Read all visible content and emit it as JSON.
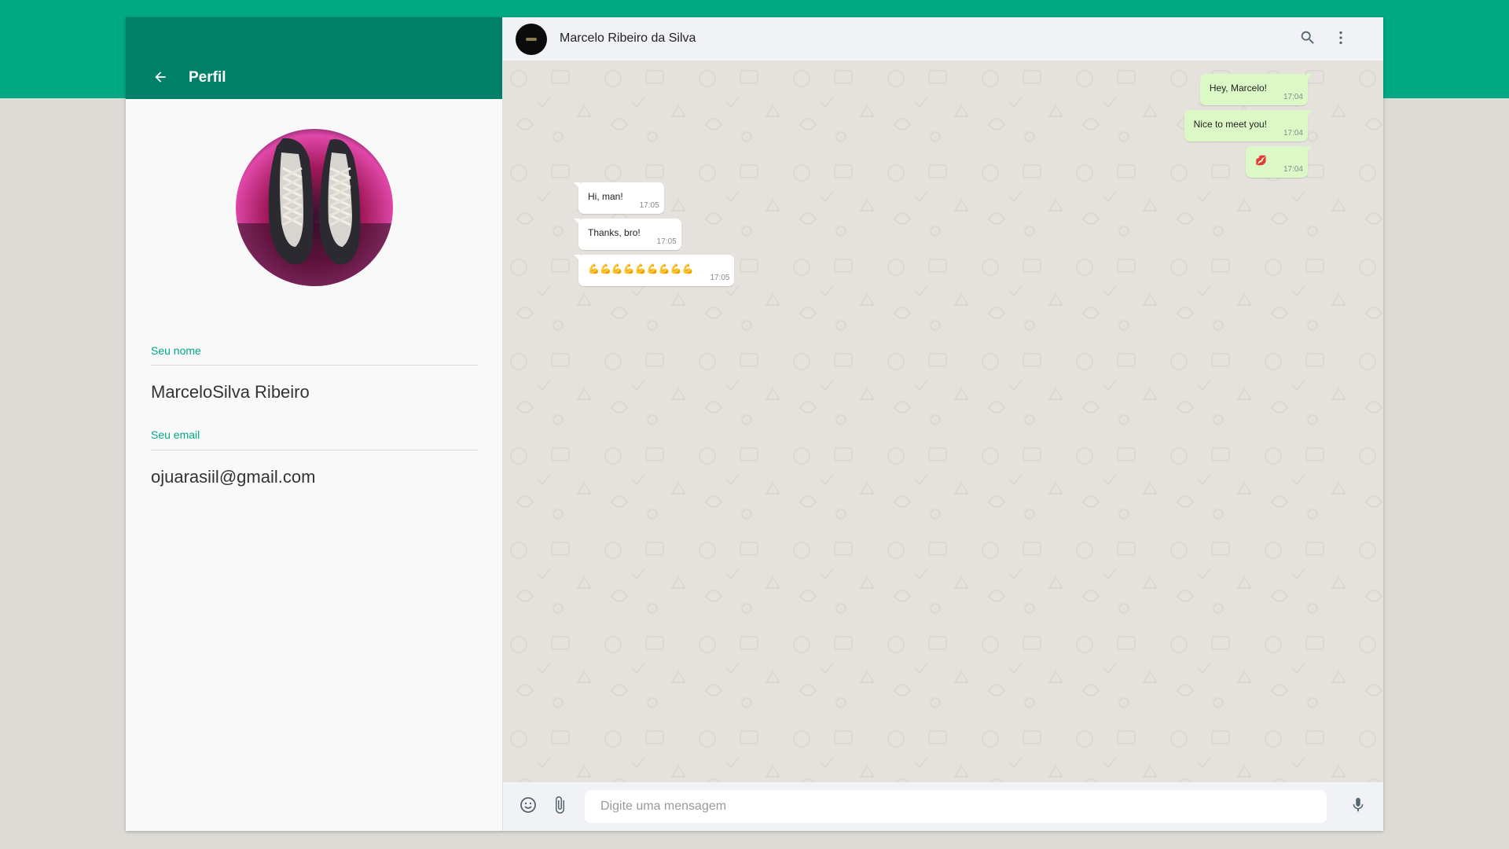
{
  "profile": {
    "title": "Perfil",
    "name_label": "Seu nome",
    "name_value": "MarceloSilva Ribeiro",
    "email_label": "Seu email",
    "email_value": "ojuarasiil@gmail.com"
  },
  "chat": {
    "contact_name": "Marcelo Ribeiro da Silva",
    "messages": [
      {
        "direction": "out",
        "text": "Hey, Marcelo!",
        "time": "17:04"
      },
      {
        "direction": "out",
        "text": "Nice to meet you!",
        "time": "17:04"
      },
      {
        "direction": "out",
        "text": "💋",
        "time": "17:04"
      },
      {
        "direction": "in",
        "text": "Hi, man!",
        "time": "17:05"
      },
      {
        "direction": "in",
        "text": "Thanks, bro!",
        "time": "17:05"
      },
      {
        "direction": "in",
        "text": "💪💪💪💪💪💪💪💪💪",
        "time": "17:05"
      }
    ]
  },
  "footer": {
    "input_placeholder": "Digite uma mensagem"
  },
  "icons": {
    "back": "arrow-left-icon",
    "search": "search-icon",
    "menu": "more-vertical-icon",
    "emoji": "emoji-icon",
    "attach": "paperclip-icon",
    "mic": "microphone-icon"
  },
  "colors": {
    "brand": "#00a884",
    "header_dark": "#008069",
    "outgoing_bubble": "#dcf8c6",
    "incoming_bubble": "#ffffff",
    "chat_background": "#e5e1dc"
  }
}
